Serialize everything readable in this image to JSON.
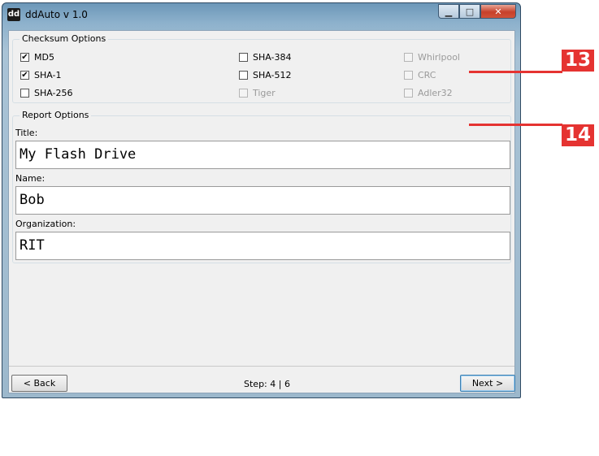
{
  "window": {
    "icon_text": "dd",
    "title": "ddAuto v 1.0",
    "controls": {
      "minimize": "▁",
      "maximize": "□",
      "close": "✕"
    }
  },
  "checksum": {
    "legend": "Checksum Options",
    "options": [
      {
        "label": "MD5",
        "checked": true,
        "enabled": true
      },
      {
        "label": "SHA-1",
        "checked": true,
        "enabled": true
      },
      {
        "label": "SHA-256",
        "checked": false,
        "enabled": true
      },
      {
        "label": "SHA-384",
        "checked": false,
        "enabled": true
      },
      {
        "label": "SHA-512",
        "checked": false,
        "enabled": true
      },
      {
        "label": "Tiger",
        "checked": false,
        "enabled": false
      },
      {
        "label": "Whirlpool",
        "checked": false,
        "enabled": false
      },
      {
        "label": "CRC",
        "checked": false,
        "enabled": false
      },
      {
        "label": "Adler32",
        "checked": false,
        "enabled": false
      }
    ]
  },
  "report": {
    "legend": "Report Options",
    "title_label": "Title:",
    "title_value": "My Flash Drive",
    "name_label": "Name:",
    "name_value": "Bob",
    "org_label": "Organization:",
    "org_value": "RIT"
  },
  "footer": {
    "back_label": "< Back",
    "step_text": "Step: 4 | 6",
    "next_label": "Next >"
  },
  "callouts": {
    "first": "13",
    "second": "14",
    "color": "#e53331"
  }
}
